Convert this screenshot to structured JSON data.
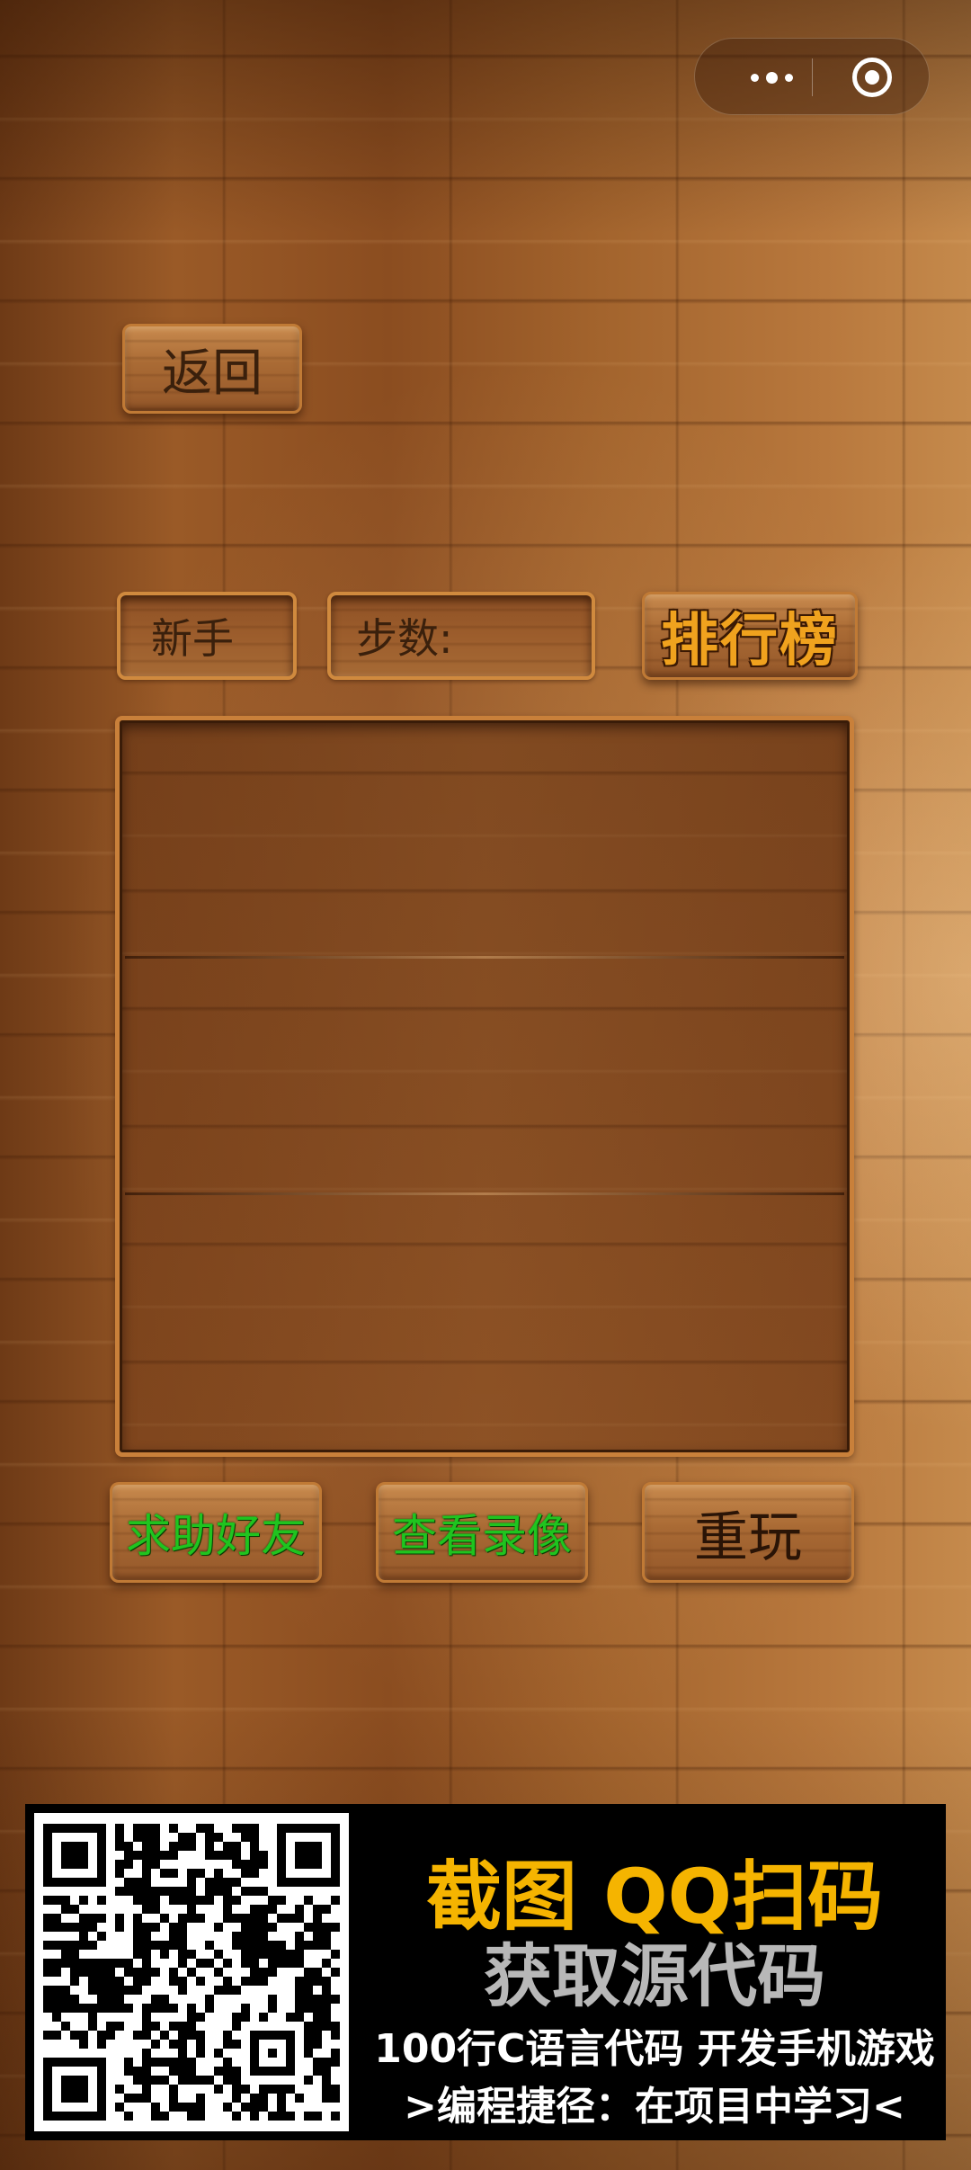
{
  "capsule": {
    "more_icon": "more-dots-icon",
    "close_icon": "target-circle-icon"
  },
  "nav": {
    "back_label": "返回"
  },
  "status": {
    "level_label": "新手",
    "steps_label": "步数:",
    "steps_value": "",
    "rank_label": "排行榜"
  },
  "board": {
    "rows": 3
  },
  "actions": {
    "help_label": "求助好友",
    "replay_label": "查看录像",
    "restart_label": "重玩"
  },
  "banner": {
    "line1": "截图 QQ扫码",
    "line2": "获取源代码",
    "line3": "100行C语言代码 开发手机游戏",
    "line4": ">编程捷径：在项目中学习<",
    "qr_icon": "qr-code-icon"
  },
  "colors": {
    "accent_gold": "#f0a21e",
    "action_green": "#1fc41f",
    "banner_yellow": "#f5b400"
  }
}
